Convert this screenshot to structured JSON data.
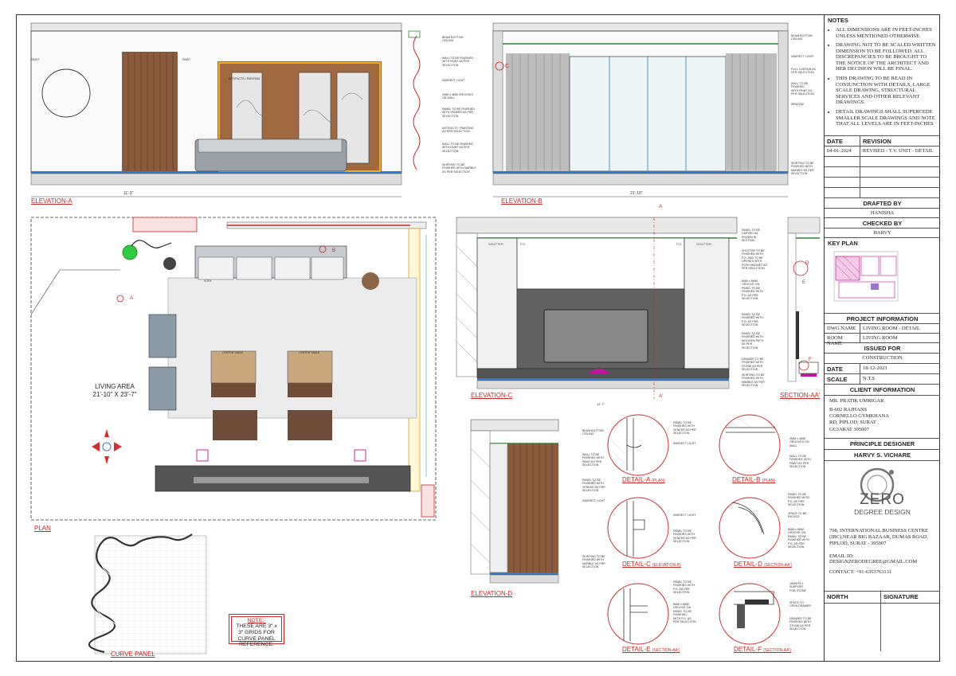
{
  "labels": {
    "elevation_a": "ELEVATION-A",
    "elevation_b": "ELEVATION-B",
    "elevation_c": "ELEVATION-C",
    "section_aa": "SECTION-AA'",
    "elevation_d": "ELEVATION-D",
    "plan": "PLAN",
    "curve_panel": "CURVE PANEL",
    "detail_a": "DETAIL-A",
    "detail_a_sub": "(PLAN)",
    "detail_b": "DETAIL-B",
    "detail_b_sub": "(PLAN)",
    "detail_c": "DETAIL-C",
    "detail_c_sub": "(ELEVATION-B)",
    "detail_d": "DETAIL-D",
    "detail_d_sub": "(SECTION-AA')",
    "detail_e": "DETAIL-E",
    "detail_e_sub": "(SECTION-AA')",
    "detail_f": "DETAIL-F",
    "detail_f_sub": "(SECTION-AA')"
  },
  "plan": {
    "room_name": "LIVING AREA",
    "room_size": "21'-10\" X 23'-7\"",
    "marker_a": "A",
    "marker_b": "B",
    "sofa": "SOFA",
    "center_table_1": "CENTER TABLE",
    "center_table_2": "CENTER TABLE"
  },
  "curve_note": {
    "title": "NOTE:-",
    "text": "THESE ARE 3\" x 3\" GRIDS FOR CURVE PANEL REFERENCE."
  },
  "elevation_a": {
    "paint_1": "PAINT",
    "paint_2": "PAINT",
    "artifacts": "ARTIFACTS / PAINTING",
    "notes": [
      "BEAM BOTTOM\nCEILING",
      "WALL TO BE FINISHED\nWITH PAINT AS PER\nSELECTION",
      "INDIRECT LIGHT",
      "2MM x 4MM GROOVES\nON WALL",
      "PANEL TO BE FINISHED\nWITH VENEER AS PER\nSELECTION",
      "ARTIFACTS / PAINTING\nAS PER SELECTION",
      "WALL TO BE FINISHED\nWITH PAINT AS PER\nSELECTION",
      "SKIRTING TO BE\nFINISHED WITH MARBLE\nAS PER SELECTION"
    ],
    "dim_total": "11'-3\""
  },
  "elevation_b": {
    "marker": "C",
    "notes": [
      "BEAM BOTTOM\nCEILING",
      "INDIRECT LIGHT",
      "FULL CURTAIN AS\nPER SELECTION",
      "WALL TO BE\nFINISHED\nWITH PAINT AS\nPER SELECTION",
      "WINDOW",
      "SKIRTING TO BE\nFINISHED WITH\nMARBLE AS PER\nSELECTION"
    ],
    "dim_total": "21'-10\""
  },
  "elevation_c": {
    "shutter_left": "SHUTTER",
    "shutter_right": "SHUTTER",
    "pg_left": "P.G.",
    "pg_right": "P.G.",
    "top_a": "A",
    "bottom_a": "A'",
    "notes": [
      "PANEL TO BE\nCARVED AS\nSHOWN IN\nSECTION",
      "SHUTTER TO BE\nFINISHED WITH\nP.G. AND TO BE\nOPENED WITH\nPUSH MAGNET AS\nPER SELECTION",
      "6MM x 6MM\nGROOVE ON\nPANEL TO BE\nFINISHED WITH\nP.G. AS PER\nSELECTION",
      "PANEL TO BE\nFINISHED WITH\nP.G. AS PER\nSELECTION",
      "PANEL TO BE\nFINISHED WITH\nWOODEN PATTI\nAS PER\nSELECTION",
      "DRAWER TO BE\nFINISHED WITH\nSTONE AS PER\nSELECTION",
      "SKIRTING TO BE\nFINISHED WITH\nMARBLE AS PER\nSELECTION"
    ],
    "dim_total": "12'-7\""
  },
  "section": {
    "marker_d": "D",
    "marker_e": "E",
    "marker_f": "F"
  },
  "elevation_d": {
    "notes": [
      "BEAM BOTTOM\nCEILING",
      "WALL TO BE\nFINISHED WITH\nPAINT AS PER\nSELECTION",
      "PANEL TO BE\nFINISHED WITH\nVENEER AS PER\nSELECTION",
      "INDIRECT LIGHT",
      "SKIRTING TO BE\nFINISHED WITH\nMARBLE AS PER\nSELECTION"
    ]
  },
  "details": {
    "a": [
      "PANEL TO BE\nFINISHED WITH\nVENEER AS PER\nSELECTION",
      "INDIRECT LIGHT"
    ],
    "b": [
      "2MM x 4MM\nGROOVES ON\nWALL",
      "WALL TO BE\nFINISHED WITH\nPAINT AS PER\nSELECTION"
    ],
    "c": [
      "INDIRECT LIGHT",
      "PANEL TO BE\nFINISHED WITH\nVENEER AS PER\nSELECTION"
    ],
    "d": [
      "PANEL TO BE\nFINISHED WITH\nP.G. AS PER\nSELECTION",
      "SPACE TO BE\nPACKED",
      "6MM x 6MM\nGROOVE ON\nPANEL TO BE\nFINISHED WITH\nP.G. AS PER\nSELECTION"
    ],
    "e": [
      "PANEL TO BE\nFINISHED WITH\nP.G. AS PER\nSELECTION",
      "6MM x 6MM\nGROOVE ON\nPANEL TO BE\nFINISHED\nWITH P.G. AS\nPER SELECTION"
    ],
    "f": [
      "18MM PLY\nSUPPORT\nFOR STONE",
      "SPACE TO\nOPEN DRAWER",
      "DRAWER TO BE\nFINISHED WITH\nSTONE AS PER\nSELECTION"
    ]
  },
  "panel": {
    "notes_title": "NOTES",
    "notes": [
      "ALL DIMENSIONS ARE IN FEET-INCHES UNLESS MENTIONED OTHERWISE.",
      "DRAWING NOT TO BE SCALED.WRITTEN DIMENSION TO BE FOLLOWED. ALL DISCREPANCIES TO BE BROUGHT TO THE NOTICE OF THE ARCHITECT AND HER DECISION WILL BE FINAL.",
      "THIS DRAWING TO BE READ IN CONJUNCTION WITH DETAILS, LARGE SCALE DRAWING, STRUCTURAL SERVICES AND OTHER RELEVANT DRAWINGS.",
      "DETAIL DRAWINGS SHALL SUPERCEDE SMALLER SCALE DRAWINGS AND NOTE THAT ALL LEVELS ARE IN FEET-INCHES"
    ],
    "date_hdr": "DATE",
    "revision_hdr": "REVISION",
    "revision_date": "04-01-2024",
    "revision_text": "REVISED - T.V. UNIT - DETAIL",
    "drafted_by_label": "DRAFTED BY",
    "drafted_by": "HANISHA",
    "checked_by_label": "CHECKED BY",
    "checked_by": "HARVY",
    "key_plan": "KEY PLAN",
    "project_info": "PROJECT INFORMATION",
    "dwg_name_label": "DWG NAME",
    "dwg_name": "LIVING ROOM - DETAIL",
    "room_name_label": "ROOM NAME",
    "room_name": "LIVING ROOM",
    "issued_for_label": "ISSUED FOR",
    "issued_for": "CONSTRUCTION",
    "date_label": "DATE",
    "date": "18-12-2023",
    "scale_label": "SCALE",
    "scale": "N.T.S",
    "client_info": "CLIENT INFORMATION",
    "client_name": "MR. PRATIK UMRIGAR",
    "client_address": "B-602  RAJHANS CORNELLO GYMKHANA RD, PIPLOD, SURAT , GUJARAT 395007",
    "principle_designer_label": "PRINCIPLE DESIGNER",
    "principle_designer": "HARVY S. VICHARE",
    "logo_main": "ZERO",
    "logo_sub": "DEGREE DESIGN",
    "office_address": "708, INTERNATIONAL BUSINESS CENTRE (IBC),NEAR BIG BAZAAR, DUMAS ROAD, PIPLOD, SURAT - 395007",
    "email_label": "EMAIL ID:",
    "email": "DESIGNZERODEGREE@GMAIL.COM",
    "contact": "CONTACT: +91-6353763131",
    "north": "NORTH",
    "signature": "SIGNATURE"
  }
}
